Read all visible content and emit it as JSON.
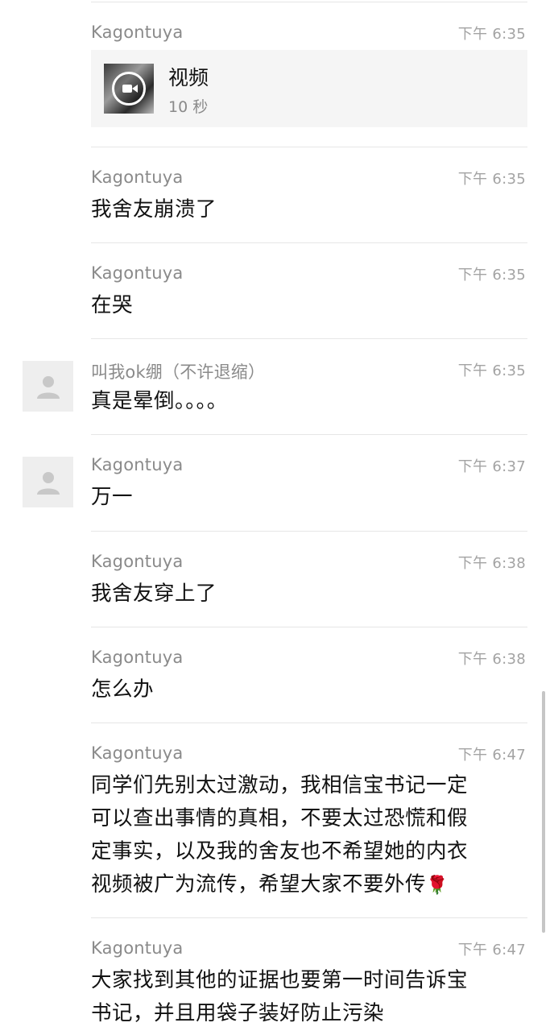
{
  "messages": [
    {
      "sender": "Kagontuya",
      "time": "下午 6:35",
      "video": {
        "title": "视频",
        "duration": "10 秒"
      }
    },
    {
      "sender": "Kagontuya",
      "time": "下午 6:35",
      "lines": [
        "我舍友崩溃了"
      ]
    },
    {
      "sender": "Kagontuya",
      "time": "下午 6:35",
      "lines": [
        "在哭"
      ]
    },
    {
      "sender": "叫我ok绷（不许退缩）",
      "time": "下午 6:35",
      "lines": [
        "真是晕倒。。。。"
      ],
      "avatar": "default-user-avatar"
    },
    {
      "sender": "Kagontuya",
      "time": "下午 6:37",
      "lines": [
        "万一"
      ],
      "avatar": "default-user-avatar"
    },
    {
      "sender": "Kagontuya",
      "time": "下午 6:38",
      "lines": [
        "我舍友穿上了"
      ]
    },
    {
      "sender": "Kagontuya",
      "time": "下午 6:38",
      "lines": [
        "怎么办"
      ]
    },
    {
      "sender": "Kagontuya",
      "time": "下午 6:47",
      "lines": [
        "同学们先别太过激动，我相信宝书记一定",
        "可以查出事情的真相，不要太过恐慌和假",
        "定事实，以及我的舍友也不希望她的内衣",
        "视频被广为流传，希望大家不要外传"
      ],
      "emoji": "🌹"
    },
    {
      "sender": "Kagontuya",
      "time": "下午 6:47",
      "lines": [
        "大家找到其他的证据也要第一时间告诉宝",
        "书记，并且用袋子装好防止污染"
      ]
    }
  ],
  "icons": {
    "video": "video-camera-icon",
    "emoji": "rose-emoji"
  }
}
